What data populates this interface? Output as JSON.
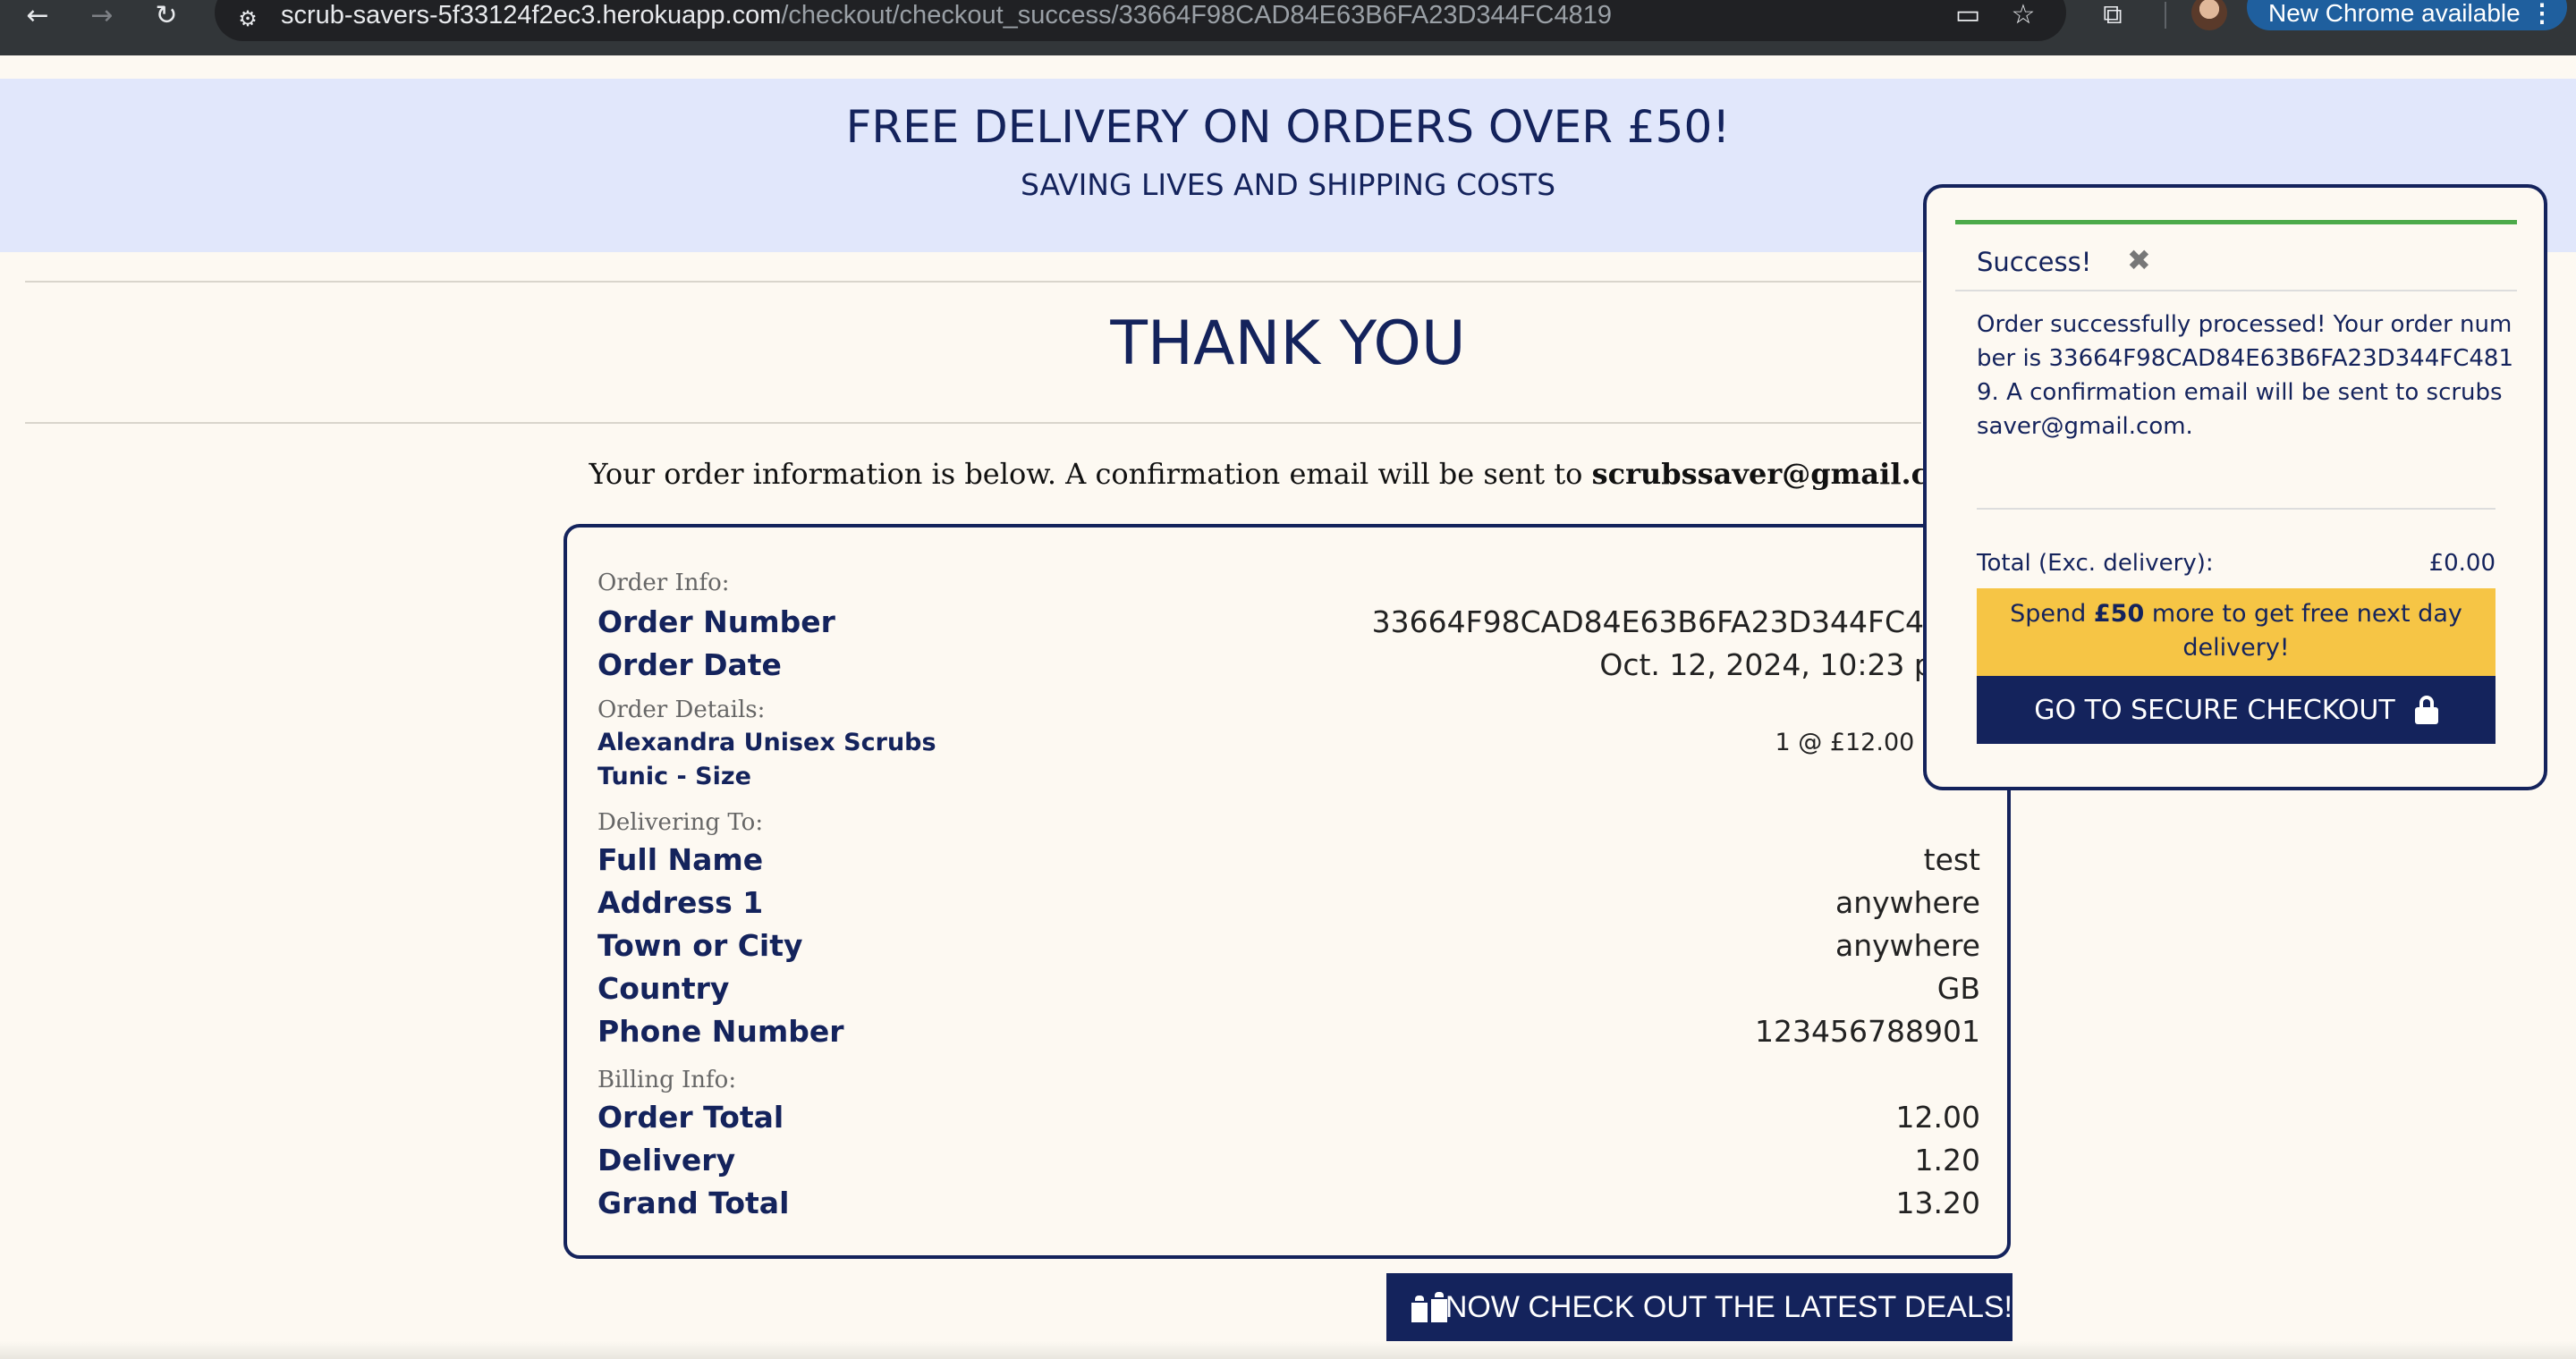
{
  "browser": {
    "url_host": "scrub-savers-5f33124f2ec3.herokuapp.com",
    "url_path": "/checkout/checkout_success/33664F98CAD84E63B6FA23D344FC4819",
    "update_label": "New Chrome available",
    "icons": [
      "back-arrow-icon",
      "forward-arrow-icon",
      "reload-icon",
      "site-info-icon",
      "tab-search-icon",
      "bookmark-star-icon",
      "extensions-icon",
      "profile-avatar",
      "menu-dots-icon"
    ]
  },
  "banner": {
    "headline": "FREE DELIVERY ON ORDERS OVER £50!",
    "tagline": "SAVING LIVES AND SHIPPING COSTS"
  },
  "main": {
    "title": "THANK YOU",
    "subtitle_prefix": "Your order information is below. A confirmation email will be sent to ",
    "email": "scrubssaver@gmail.com",
    "subtitle_suffix": "."
  },
  "order": {
    "info_label": "Order Info:",
    "number_label": "Order Number",
    "number_value": "33664F98CAD84E63B6FA23D344FC4819",
    "date_label": "Order Date",
    "date_value": "Oct. 12, 2024, 10:23 p.m.",
    "details_label": "Order Details:",
    "item_name": "Alexandra Unisex Scrubs Tunic - Size",
    "item_qty": "1 @ £12.00 each",
    "delivering_label": "Delivering To:",
    "full_name_label": "Full Name",
    "full_name_value": "test",
    "address1_label": "Address 1",
    "address1_value": "anywhere",
    "town_label": "Town or City",
    "town_value": "anywhere",
    "country_label": "Country",
    "country_value": "GB",
    "phone_label": "Phone Number",
    "phone_value": "123456788901",
    "billing_label": "Billing Info:",
    "order_total_label": "Order Total",
    "order_total_value": "12.00",
    "delivery_label": "Delivery",
    "delivery_value": "1.20",
    "grand_total_label": "Grand Total",
    "grand_total_value": "13.20"
  },
  "deals_button": {
    "label": "NOW CHECK OUT THE LATEST DEALS!",
    "icon": "gifts-icon"
  },
  "toast": {
    "title": "Success!",
    "close_icon": "close-icon",
    "message": "Order successfully processed! Your order number is 33664F98CAD84E63B6FA23D344FC4819. A confirmation email will be sent to scrubssaver@gmail.com.",
    "total_label": "Total (Exc. delivery):",
    "total_value": "£0.00",
    "spend_prefix": "Spend ",
    "spend_amount": "£50",
    "spend_suffix": " more to get free next day delivery!",
    "checkout_label": "GO TO SECURE CHECKOUT",
    "accent_color": "#4caa4a"
  },
  "colors": {
    "navy": "#14235c",
    "banner_bg": "#e1e7fb",
    "page_bg": "#fdf9f2",
    "spend_bg": "#f6c545"
  }
}
